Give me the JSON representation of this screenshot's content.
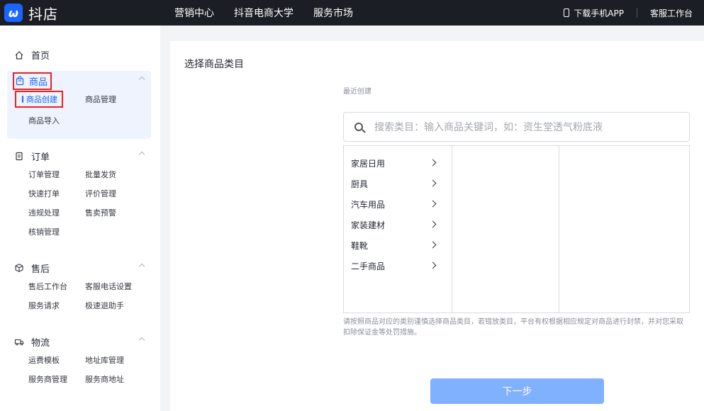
{
  "brand": {
    "logo_glyph": "ω",
    "name": "抖店"
  },
  "top_nav": [
    "营销中心",
    "抖音电商大学",
    "服务市场"
  ],
  "top_right": {
    "download_app": "下载手机APP",
    "customer_service": "客服工作台"
  },
  "sidebar": {
    "home": "首页",
    "sections": [
      {
        "title": "商品",
        "icon": "bag-icon",
        "items": [
          "商品创建",
          "商品管理",
          "商品导入"
        ]
      },
      {
        "title": "订单",
        "icon": "clipboard-icon",
        "items": [
          "订单管理",
          "批量发货",
          "快速打单",
          "评价管理",
          "违规处理",
          "售卖预警",
          "核销管理"
        ]
      },
      {
        "title": "售后",
        "icon": "box-icon",
        "items": [
          "售后工作台",
          "客服电话设置",
          "服务请求",
          "极速退助手"
        ]
      },
      {
        "title": "物流",
        "icon": "truck-icon",
        "items": [
          "运费模板",
          "地址库管理",
          "服务商管理",
          "服务商地址"
        ]
      }
    ]
  },
  "main": {
    "title": "选择商品类目",
    "recent_label": "最近创建",
    "search_placeholder": "搜索类目：输入商品关键词，如：资生堂透气粉底液",
    "categories": [
      "家居日用",
      "厨具",
      "汽车用品",
      "家装建材",
      "鞋靴",
      "二手商品"
    ],
    "notice": "请按照商品对应的类别谨慎选择商品类目，若错放类目，平台有权根据相应规定对商品进行封禁，并对您采取扣除保证金等处罚措施。",
    "next_button": "下一步"
  },
  "colors": {
    "accent": "#1966ff",
    "topbar": "#1b1e25",
    "button_disabled": "#80b1ff",
    "highlight_box": "#ee2222"
  }
}
